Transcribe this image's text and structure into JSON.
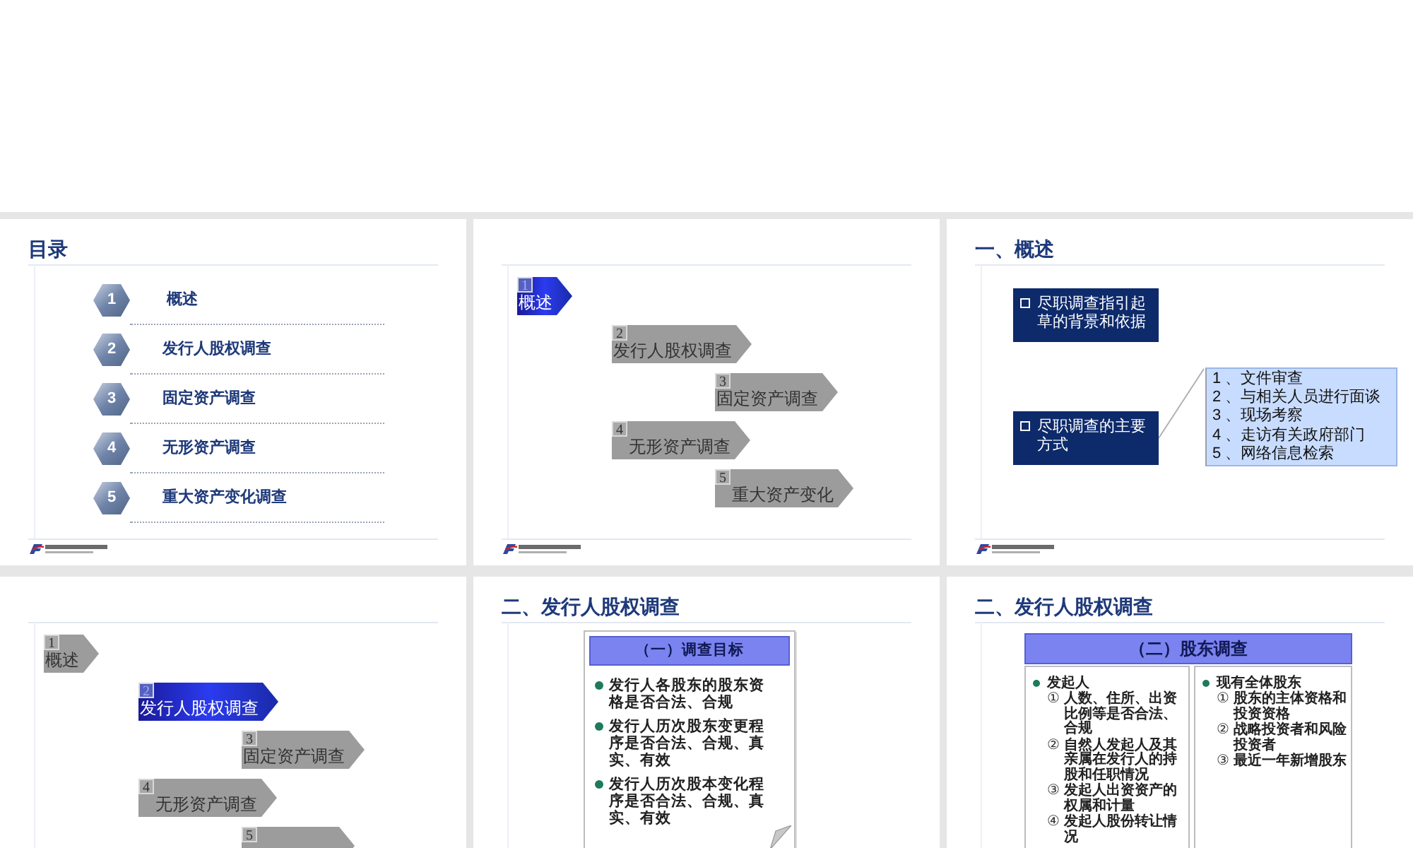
{
  "slides": [
    {
      "kind": "toc",
      "title": "目录",
      "items": [
        {
          "number": "1",
          "label": "概述"
        },
        {
          "number": "2",
          "label": "发行人股权调查"
        },
        {
          "number": "3",
          "label": "固定资产调查"
        },
        {
          "number": "4",
          "label": "无形资产调查"
        },
        {
          "number": "5",
          "label": "重大资产变化调查"
        }
      ]
    },
    {
      "kind": "agenda",
      "items": [
        {
          "number": "1",
          "label": "概述",
          "selected": true
        },
        {
          "number": "2",
          "label": "发行人股权调查",
          "selected": false
        },
        {
          "number": "3",
          "label": "固定资产调查",
          "selected": false
        },
        {
          "number": "4",
          "label": "无形资产调查",
          "selected": false
        },
        {
          "number": "5",
          "label": "重大资产变化",
          "selected": false
        }
      ]
    },
    {
      "kind": "overview",
      "title": "一、概述",
      "points": [
        "尽职调查指引起草的背景和依据",
        "尽职调查的主要方式"
      ],
      "methods": [
        "1 、文件审查",
        "2 、与相关人员进行面谈",
        "3 、现场考察",
        "4 、走访有关政府部门",
        "5 、网络信息检索"
      ]
    },
    {
      "kind": "agenda",
      "items": [
        {
          "number": "1",
          "label": "概述",
          "selected": false
        },
        {
          "number": "2",
          "label": "发行人股权调查",
          "selected": true
        },
        {
          "number": "3",
          "label": "固定资产调查",
          "selected": false
        },
        {
          "number": "4",
          "label": "无形资产调查",
          "selected": false
        },
        {
          "number": "5",
          "selected": false
        }
      ]
    },
    {
      "kind": "goals",
      "title": "二、发行人股权调查",
      "heading": "（一）调查目标",
      "bullets": [
        "发行人各股东的股东资格是否合法、合规",
        "发行人历次股东变更程序是否合法、合规、真实、有效",
        "发行人历次股本变化程序是否合法、合规、真实、有效"
      ]
    },
    {
      "kind": "shareholders",
      "title": "二、发行人股权调查",
      "heading": "（二）股东调查",
      "groups": [
        {
          "label": "发起人",
          "items": [
            {
              "marker": "①",
              "text": "人数、住所、出资比例等是否合法、合规"
            },
            {
              "marker": "②",
              "text": "自然人发起人及其亲属在发行人的持股和任职情况"
            },
            {
              "marker": "③",
              "text": "发起人出资资产的权属和计量"
            },
            {
              "marker": "④",
              "text": "发起人股份转让情况"
            }
          ]
        },
        {
          "label": "现有全体股东",
          "items": [
            {
              "marker": "①",
              "text": "股东的主体资格和投资资格"
            },
            {
              "marker": "②",
              "text": "战略投资者和风险投资者"
            },
            {
              "marker": "③",
              "text": "最近一年新增股东"
            }
          ]
        }
      ]
    }
  ]
}
